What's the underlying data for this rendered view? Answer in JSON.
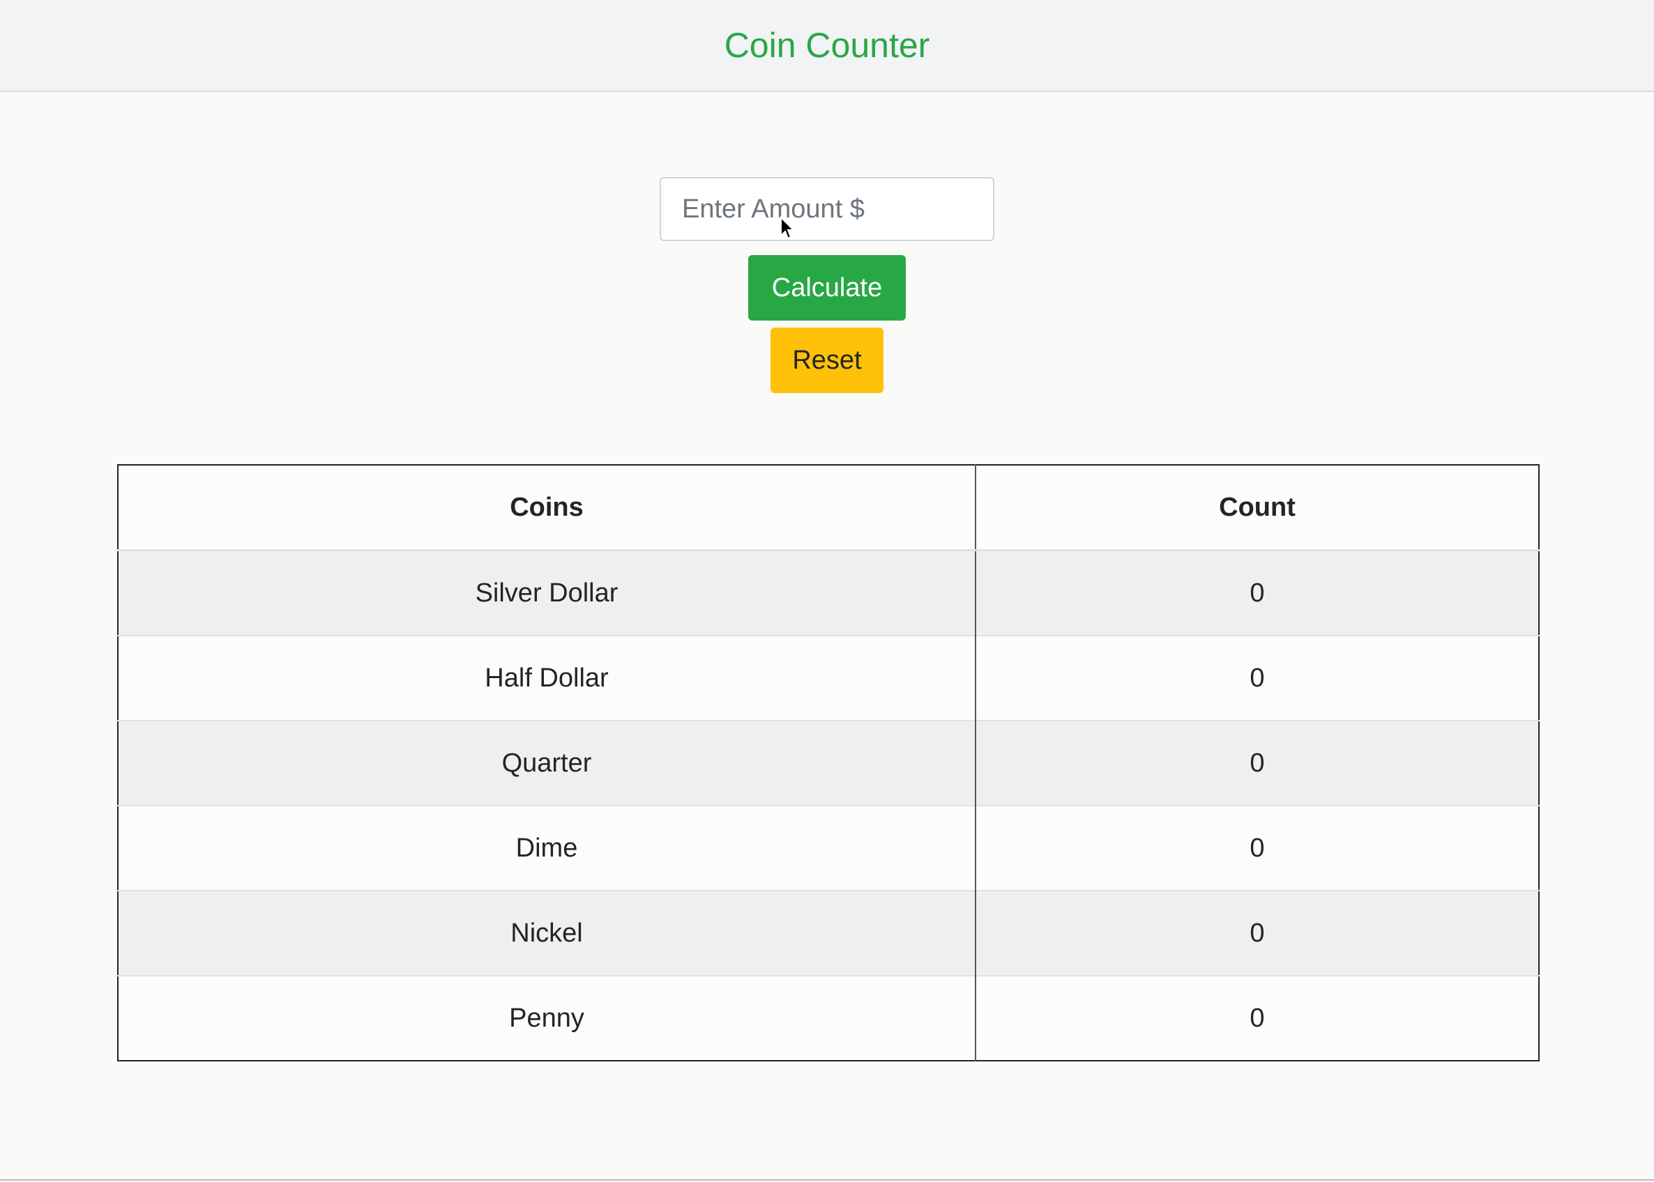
{
  "header": {
    "title": "Coin Counter"
  },
  "form": {
    "amount_placeholder": "Enter Amount $",
    "amount_value": "",
    "calculate_label": "Calculate",
    "reset_label": "Reset"
  },
  "table": {
    "headers": [
      "Coins",
      "Count"
    ],
    "rows": [
      {
        "coin": "Silver Dollar",
        "count": "0"
      },
      {
        "coin": "Half Dollar",
        "count": "0"
      },
      {
        "coin": "Quarter",
        "count": "0"
      },
      {
        "coin": "Dime",
        "count": "0"
      },
      {
        "coin": "Nickel",
        "count": "0"
      },
      {
        "coin": "Penny",
        "count": "0"
      }
    ]
  },
  "colors": {
    "title": "#28a745",
    "calculate_button": "#28a745",
    "reset_button": "#ffc107"
  }
}
